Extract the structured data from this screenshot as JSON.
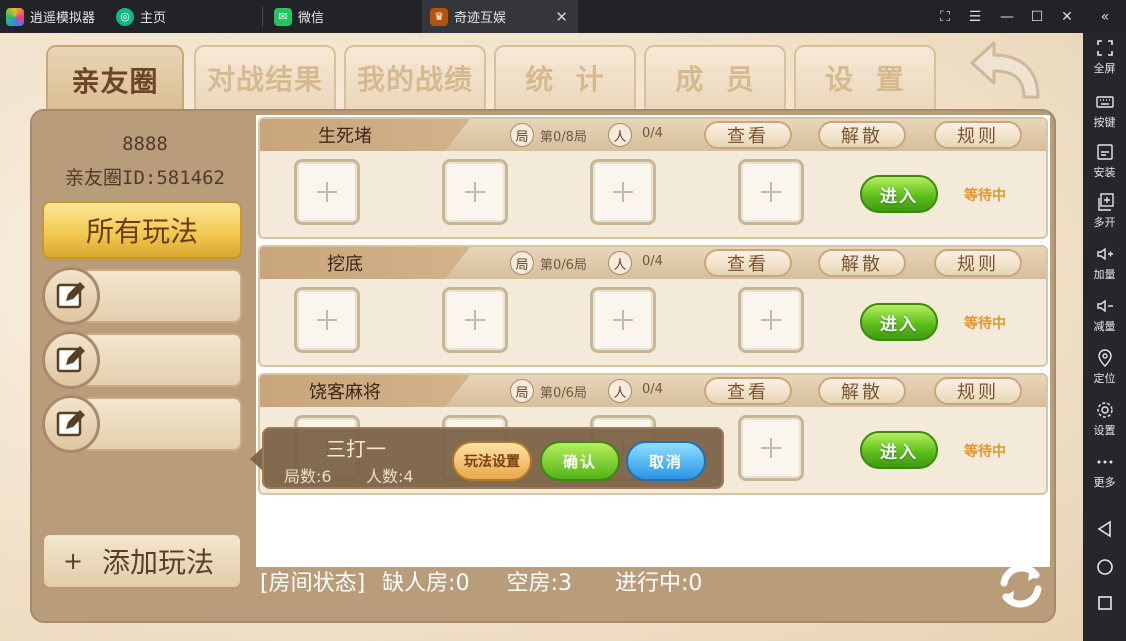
{
  "titlebar": {
    "app_name": "逍遥模拟器",
    "tabs": [
      {
        "label": "主页"
      },
      {
        "label": "微信"
      },
      {
        "label": "奇迹互娱"
      }
    ]
  },
  "sidebar": {
    "items": [
      {
        "label": "全屏",
        "icon": "fullscreen-icon"
      },
      {
        "label": "按键",
        "icon": "keyboard-icon"
      },
      {
        "label": "安装",
        "icon": "apk-icon"
      },
      {
        "label": "多开",
        "icon": "multi-open-icon"
      },
      {
        "label": "加量",
        "icon": "volume-up-icon"
      },
      {
        "label": "减量",
        "icon": "volume-down-icon"
      },
      {
        "label": "定位",
        "icon": "location-icon"
      },
      {
        "label": "设置",
        "icon": "gear-icon"
      },
      {
        "label": "更多",
        "icon": "more-icon"
      }
    ]
  },
  "tabs": [
    {
      "label": "亲友圈",
      "active": true
    },
    {
      "label": "对战结果",
      "active": false
    },
    {
      "label": "我的战绩",
      "active": false
    },
    {
      "label": "统  计",
      "active": false
    },
    {
      "label": "成  员",
      "active": false
    },
    {
      "label": "设  置",
      "active": false
    }
  ],
  "club": {
    "name": "8888",
    "id_text": "亲友圈ID:581462"
  },
  "modes": {
    "all_label": "所有玩法",
    "add_label": "添加玩法",
    "add_symbol": "+"
  },
  "rooms": [
    {
      "title": "生死堵",
      "round_badge": "局",
      "rounds": "第0/8局",
      "people_badge": "人",
      "people": "0/4",
      "view": "查看",
      "dismiss": "解散",
      "rules": "规则",
      "enter": "进入",
      "status": "等待中"
    },
    {
      "title": "挖底",
      "round_badge": "局",
      "rounds": "第0/6局",
      "people_badge": "人",
      "people": "0/4",
      "view": "查看",
      "dismiss": "解散",
      "rules": "规则",
      "enter": "进入",
      "status": "等待中"
    },
    {
      "title": "饶客麻将",
      "round_badge": "局",
      "rounds": "第0/6局",
      "people_badge": "人",
      "people": "0/4",
      "view": "查看",
      "dismiss": "解散",
      "rules": "规则",
      "enter": "进入",
      "status": "等待中"
    }
  ],
  "popup": {
    "title": "三打一",
    "rounds": "局数:6",
    "people": "人数:4",
    "settings": "玩法设置",
    "confirm": "确认",
    "cancel": "取消"
  },
  "status_bar": {
    "label": "[房间状态]",
    "missing": "缺人房:0",
    "empty": "空房:3",
    "in_progress": "进行中:0"
  },
  "colors": {
    "accent_gold": "#f1c74d",
    "enter_green": "#58bb1a",
    "cancel_blue": "#2a94e4",
    "waiting_orange": "#e2962c"
  }
}
